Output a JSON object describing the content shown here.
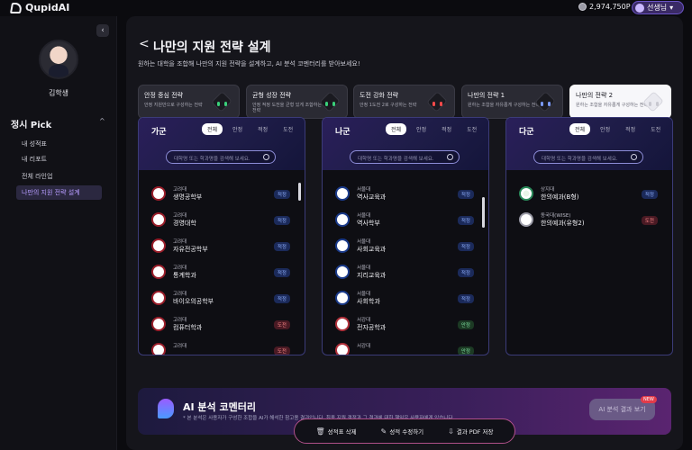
{
  "app": {
    "logo_text": "QupidAI"
  },
  "topbar": {
    "points": "2,974,750P",
    "user_label": "선생님"
  },
  "sidebar": {
    "collapse_icon": "‹",
    "student_name": "김학생",
    "section_title": "정시 Pick",
    "section_chevron": "^",
    "items": [
      {
        "label": "내 성적표"
      },
      {
        "label": "내 리포트"
      },
      {
        "label": "전체 라인업"
      },
      {
        "label": "나만의 지원 전략 설계"
      }
    ]
  },
  "main": {
    "back_icon": "<",
    "title": "나만의 지원 전략 설계",
    "subtitle": "원하는 대학을 조합해 나만의 지원 전략을 설계하고, AI 분석 코멘터리를 받아보세요!"
  },
  "strategies": [
    {
      "title": "안정 중심 전략",
      "desc": "안정 지원만으로 구성하는 전략",
      "eye_color": "#3ad07a"
    },
    {
      "title": "균형 성장 전략",
      "desc": "안정 적정 도전을 균형 있게 조합하는 전략",
      "eye_color": "#3ad07a"
    },
    {
      "title": "도전 강화 전략",
      "desc": "안정 1도전 2로 구성하는 전략",
      "eye_color": "#ff4a4a"
    },
    {
      "title": "나만의 전략 1",
      "desc": "원하는 조합을 자유롭게 구성하는 전략",
      "eye_color": "#7a9aff"
    },
    {
      "title": "나만의 전략 2",
      "desc": "원하는 조합을 자유롭게 구성하는 전략",
      "eye_color": "#c8c8d0"
    }
  ],
  "columns": [
    {
      "name": "가군",
      "tabs": [
        "전체",
        "안정",
        "적정",
        "도전"
      ],
      "search_placeholder": "대학명 또는 학과명을 검색해 보세요.",
      "rows": [
        {
          "uni": "고려대",
          "dept": "생명공학부",
          "badge": "적정",
          "badge_type": "fit",
          "emblem": "red"
        },
        {
          "uni": "고려대",
          "dept": "경영대학",
          "badge": "적정",
          "badge_type": "fit",
          "emblem": "red"
        },
        {
          "uni": "고려대",
          "dept": "자유전공학부",
          "badge": "적정",
          "badge_type": "fit",
          "emblem": "red"
        },
        {
          "uni": "고려대",
          "dept": "통계학과",
          "badge": "적정",
          "badge_type": "fit",
          "emblem": "red"
        },
        {
          "uni": "고려대",
          "dept": "바이오의공학부",
          "badge": "적정",
          "badge_type": "fit",
          "emblem": "red"
        },
        {
          "uni": "고려대",
          "dept": "컴퓨터학과",
          "badge": "도전",
          "badge_type": "challenge",
          "emblem": "red"
        },
        {
          "uni": "고려대",
          "dept": "",
          "badge": "도전",
          "badge_type": "challenge",
          "emblem": "red"
        }
      ]
    },
    {
      "name": "나군",
      "tabs": [
        "전체",
        "안정",
        "적정",
        "도전"
      ],
      "search_placeholder": "대학명 또는 학과명을 검색해 보세요.",
      "rows": [
        {
          "uni": "서울대",
          "dept": "역사교육과",
          "badge": "적정",
          "badge_type": "fit",
          "emblem": "blue"
        },
        {
          "uni": "서울대",
          "dept": "역사학부",
          "badge": "적정",
          "badge_type": "fit",
          "emblem": "blue"
        },
        {
          "uni": "서울대",
          "dept": "사회교육과",
          "badge": "적정",
          "badge_type": "fit",
          "emblem": "blue"
        },
        {
          "uni": "서울대",
          "dept": "지리교육과",
          "badge": "적정",
          "badge_type": "fit",
          "emblem": "blue"
        },
        {
          "uni": "서울대",
          "dept": "사회학과",
          "badge": "적정",
          "badge_type": "fit",
          "emblem": "blue"
        },
        {
          "uni": "서강대",
          "dept": "전자공학과",
          "badge": "안정",
          "badge_type": "safe",
          "emblem": "red2"
        },
        {
          "uni": "서강대",
          "dept": "",
          "badge": "안정",
          "badge_type": "safe",
          "emblem": "red2"
        }
      ]
    },
    {
      "name": "다군",
      "tabs": [
        "전체",
        "안정",
        "적정",
        "도전"
      ],
      "search_placeholder": "대학명 또는 학과명을 검색해 보세요.",
      "rows": [
        {
          "uni": "상지대",
          "dept": "한의예과(B형)",
          "badge": "적정",
          "badge_type": "fit",
          "emblem": "green"
        },
        {
          "uni": "동국대(WISE)",
          "dept": "한의예과(유형2)",
          "badge": "도전",
          "badge_type": "challenge",
          "emblem": "gray"
        }
      ]
    }
  ],
  "ai": {
    "title": "AI 분석 코멘터리",
    "note": "* 본 분석은 사용자가 구성한 조합을 AI가 해석한 참고용 결과입니다. 최종 지원 결정과 그 결과에 대한 책임은 사용자에게 있습니다.",
    "button": "AI 분석 결과 보기",
    "new_badge": "NEW"
  },
  "actions": [
    {
      "icon": "🗑",
      "label": "성적표 삭제"
    },
    {
      "icon": "✎",
      "label": "성적 수정하기"
    },
    {
      "icon": "⇩",
      "label": "결과 PDF 저장"
    }
  ]
}
